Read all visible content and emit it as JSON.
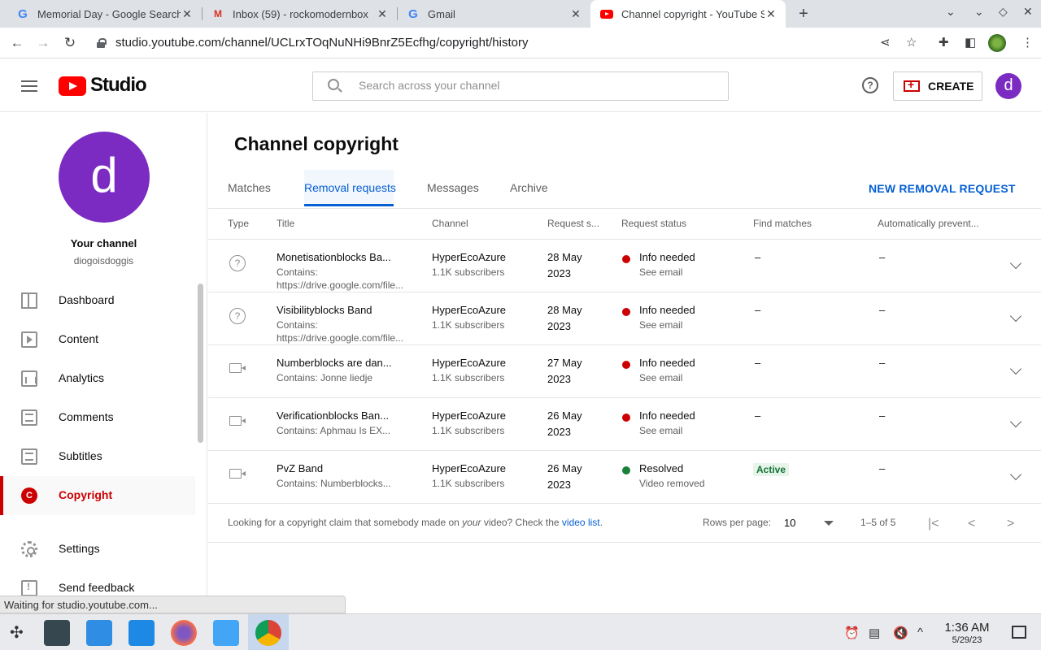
{
  "browser": {
    "tabs": [
      {
        "title": "Memorial Day - Google Search",
        "icon": "google-g-icon"
      },
      {
        "title": "Inbox (59) - rockomodernbox",
        "icon": "gmail-icon"
      },
      {
        "title": "Gmail",
        "icon": "google-g-icon"
      },
      {
        "title": "Channel copyright - YouTube Studio",
        "icon": "youtube-icon"
      }
    ],
    "url": "studio.youtube.com/channel/UCLrxTOqNuNHi9BnrZ5Ecfhg/copyright/history"
  },
  "header": {
    "logo_text": "Studio",
    "search_placeholder": "Search across your channel",
    "help_glyph": "?",
    "create_label": "CREATE",
    "avatar_letter": "d"
  },
  "sidebar": {
    "avatar_letter": "d",
    "channel_title": "Your channel",
    "channel_handle": "diogoisdoggis",
    "items": [
      {
        "label": "Dashboard",
        "icon": "dashboard-icon"
      },
      {
        "label": "Content",
        "icon": "content-icon"
      },
      {
        "label": "Analytics",
        "icon": "analytics-icon"
      },
      {
        "label": "Comments",
        "icon": "comments-icon"
      },
      {
        "label": "Subtitles",
        "icon": "subtitles-icon"
      },
      {
        "label": "Copyright",
        "icon": "copyright-icon",
        "glyph": "C",
        "selected": true
      },
      {
        "label": "Settings",
        "icon": "settings-icon"
      },
      {
        "label": "Send feedback",
        "icon": "feedback-icon"
      }
    ]
  },
  "main": {
    "title": "Channel copyright",
    "tabs": [
      "Matches",
      "Removal requests",
      "Messages",
      "Archive"
    ],
    "selected_tab": "Removal requests",
    "new_request_label": "NEW REMOVAL REQUEST",
    "columns": [
      "Type",
      "Title",
      "Channel",
      "Request s...",
      "Request status",
      "Find matches",
      "Automatically prevent..."
    ],
    "rows": [
      {
        "type": "question",
        "title": "Monetisationblocks Ba...",
        "contains1": "Contains:",
        "contains2": "https://drive.google.com/file...",
        "channel": "HyperEcoAzure",
        "subs": "1.1K subscribers",
        "date1": "28 May",
        "date2": "2023",
        "status": "Info needed",
        "status_sub": "See email",
        "status_color": "#cc0000",
        "find": "–",
        "auto": "–"
      },
      {
        "type": "question",
        "title": "Visibilityblocks Band",
        "contains1": "Contains:",
        "contains2": "https://drive.google.com/file...",
        "channel": "HyperEcoAzure",
        "subs": "1.1K subscribers",
        "date1": "28 May",
        "date2": "2023",
        "status": "Info needed",
        "status_sub": "See email",
        "status_color": "#cc0000",
        "find": "–",
        "auto": "–"
      },
      {
        "type": "video",
        "title": "Numberblocks are dan...",
        "contains1": "Contains: Jonne liedje",
        "contains2": "",
        "channel": "HyperEcoAzure",
        "subs": "1.1K subscribers",
        "date1": "27 May",
        "date2": "2023",
        "status": "Info needed",
        "status_sub": "See email",
        "status_color": "#cc0000",
        "find": "–",
        "auto": "–"
      },
      {
        "type": "video",
        "title": "Verificationblocks Ban...",
        "contains1": "Contains: Aphmau Is EX...",
        "contains2": "",
        "channel": "HyperEcoAzure",
        "subs": "1.1K subscribers",
        "date1": "26 May",
        "date2": "2023",
        "status": "Info needed",
        "status_sub": "See email",
        "status_color": "#cc0000",
        "find": "–",
        "auto": "–"
      },
      {
        "type": "video",
        "title": "PvZ Band",
        "contains1": "Contains: Numberblocks...",
        "contains2": "",
        "channel": "HyperEcoAzure",
        "subs": "1.1K subscribers",
        "date1": "26 May",
        "date2": "2023",
        "status": "Resolved",
        "status_sub": "Video removed",
        "status_color": "#188038",
        "find_badge": "Active",
        "auto": "–"
      }
    ],
    "footer": {
      "text_before": "Looking for a copyright claim that somebody made on ",
      "text_em": "your",
      "text_after": " video? Check the ",
      "link": "video list",
      "period": ".",
      "rows_per_page_label": "Rows per page:",
      "rows_per_page": "10",
      "range": "1–5 of 5"
    }
  },
  "status_bubble": "Waiting for studio.youtube.com...",
  "taskbar": {
    "time": "1:36 AM",
    "date": "5/29/23"
  }
}
